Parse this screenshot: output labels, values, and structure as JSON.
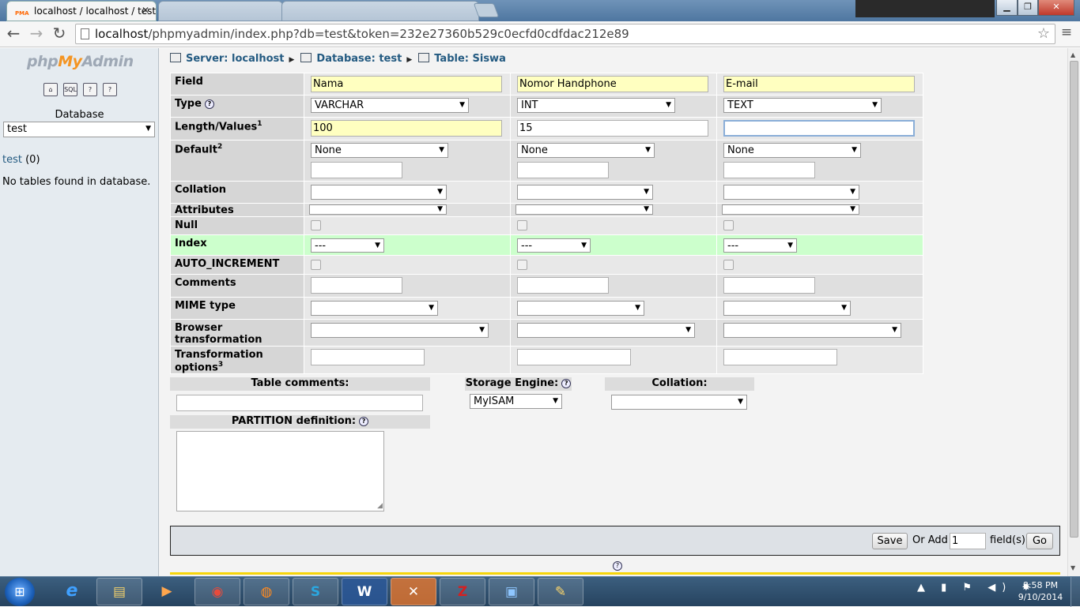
{
  "browser": {
    "tabs": [
      {
        "title": "localhost / localhost / test",
        "favicon": "PMA",
        "active": true
      },
      {
        "title": "",
        "active": false
      },
      {
        "title": "",
        "active": false
      }
    ],
    "url_host": "localhost",
    "url_path": "/phpmyadmin/index.php?db=test&token=232e27360b529c0ecfd0cdfdac212e89",
    "back_icon": "←",
    "forward_icon": "→",
    "reload_icon": "↻",
    "star_icon": "☆",
    "menu_icon": "≡",
    "window_minimize": "▁",
    "window_maximize": "❐",
    "window_close": "✕"
  },
  "sidebar": {
    "logo_php": "php",
    "logo_my": "My",
    "logo_admin": "Admin",
    "icons": [
      "home-icon",
      "sql-icon",
      "docs-icon",
      "wiki-icon"
    ],
    "icon_glyphs": [
      "⌂",
      "SQL",
      "?",
      "?"
    ],
    "database_label": "Database",
    "database_selected": "test",
    "db_link": "test",
    "db_count": "(0)",
    "no_tables": "No tables found in database."
  },
  "breadcrumb": {
    "server": "Server: localhost",
    "database": "Database: test",
    "table": "Table: Siswa"
  },
  "form": {
    "labels": {
      "field": "Field",
      "type": "Type",
      "length": "Length/Values",
      "length_sup": "1",
      "default": "Default",
      "default_sup": "2",
      "collation": "Collation",
      "attributes": "Attributes",
      "null": "Null",
      "index": "Index",
      "auto_increment": "AUTO_INCREMENT",
      "comments": "Comments",
      "mime": "MIME type",
      "browser_transformation": "Browser transformation",
      "transformation_options": "Transformation options",
      "transformation_sup": "3"
    },
    "columns": [
      {
        "name": "Nama",
        "type": "VARCHAR",
        "length": "100",
        "default": "None",
        "index": "---"
      },
      {
        "name": "Nomor Handphone",
        "type": "INT",
        "length": "15",
        "default": "None",
        "index": "---"
      },
      {
        "name": "E-mail",
        "type": "TEXT",
        "length": "",
        "default": "None",
        "index": "---"
      }
    ]
  },
  "table_options": {
    "comments_label": "Table comments:",
    "engine_label": "Storage Engine:",
    "engine_value": "MyISAM",
    "collation_label": "Collation:",
    "partition_label": "PARTITION definition:"
  },
  "savebar": {
    "save": "Save",
    "or_add": "Or Add",
    "add_count": "1",
    "fields": "field(s)",
    "go": "Go"
  },
  "taskbar": {
    "start": "⊞",
    "apps": [
      "ie-icon",
      "explorer-icon",
      "media-player-icon",
      "chrome-icon",
      "firefox-icon",
      "skype-icon",
      "word-icon",
      "xampp-icon",
      "filezilla-icon",
      "photo-viewer-icon",
      "paint-icon"
    ],
    "app_glyphs": [
      "e",
      "▤",
      "▶",
      "◉",
      "◍",
      "S",
      "W",
      "✕",
      "Z",
      "▣",
      "✎"
    ],
    "tray": "▲ ▮ ⚑ ◀) ✸",
    "time": "8:58 PM",
    "date": "9/10/2014"
  },
  "colors": {
    "link": "#235a81",
    "highlight_row": "#ccffcc",
    "input_yellow": "#ffffc0",
    "logo_orange": "#f49422"
  }
}
